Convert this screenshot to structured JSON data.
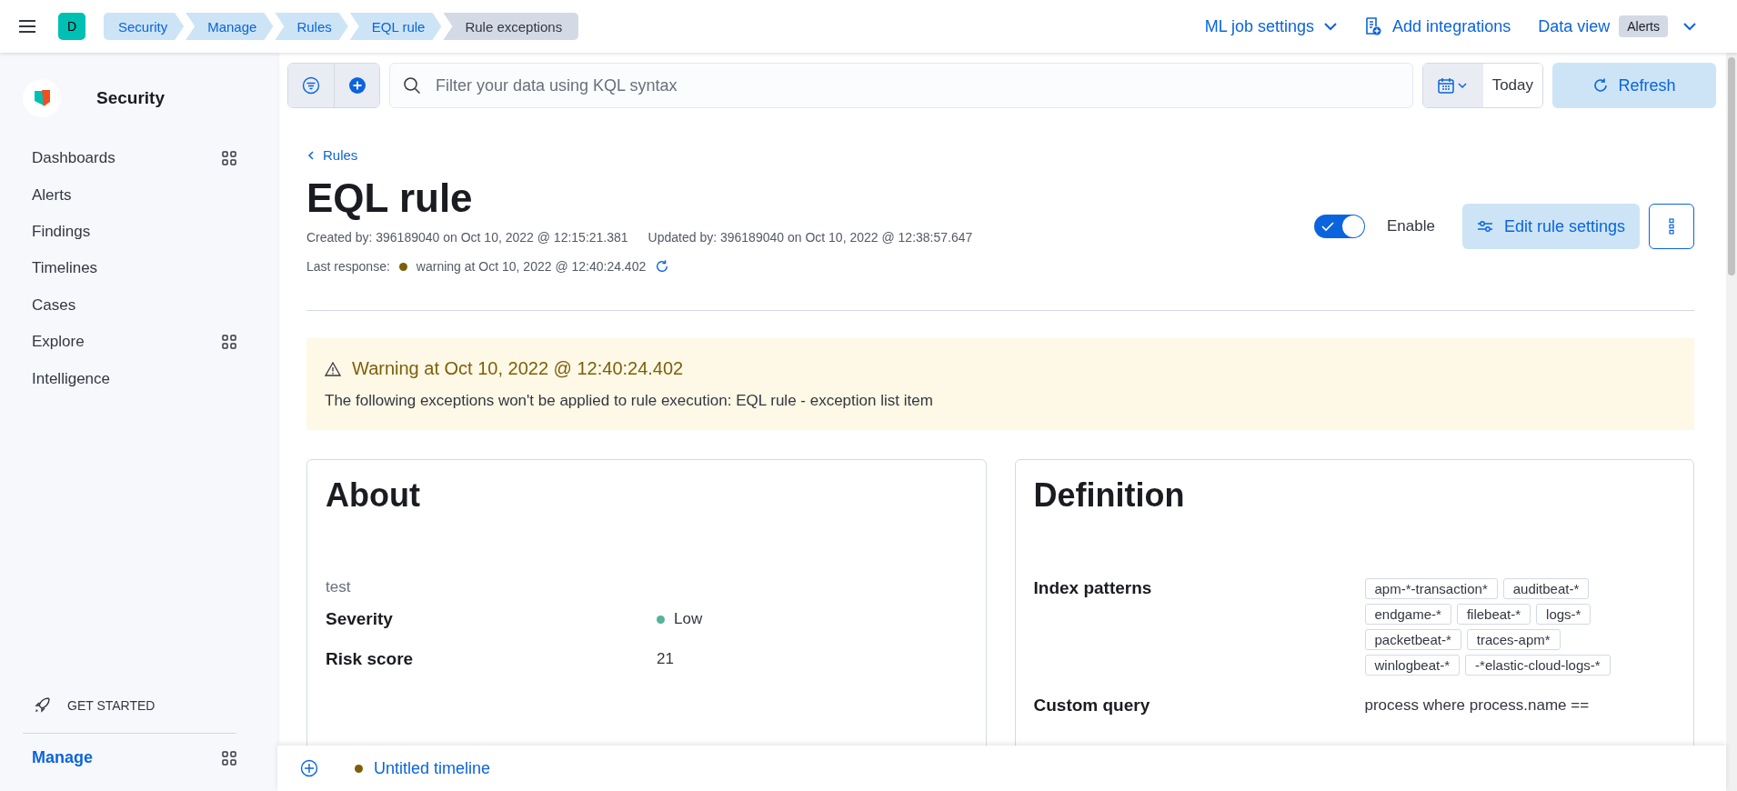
{
  "header": {
    "avatar": "D",
    "breadcrumbs": [
      {
        "label": "Security",
        "selected": false
      },
      {
        "label": "Manage",
        "selected": false
      },
      {
        "label": "Rules",
        "selected": false
      },
      {
        "label": "EQL rule",
        "selected": false
      },
      {
        "label": "Rule exceptions",
        "selected": true
      }
    ],
    "ml_job_settings": "ML job settings",
    "add_integrations": "Add integrations",
    "data_view": {
      "label": "Data view",
      "value": "Alerts"
    }
  },
  "sidebar": {
    "title": "Security",
    "items": [
      {
        "label": "Dashboards",
        "grid": true
      },
      {
        "label": "Alerts",
        "grid": false
      },
      {
        "label": "Findings",
        "grid": false
      },
      {
        "label": "Timelines",
        "grid": false
      },
      {
        "label": "Cases",
        "grid": false
      },
      {
        "label": "Explore",
        "grid": true
      },
      {
        "label": "Intelligence",
        "grid": false
      }
    ],
    "get_started": "GET STARTED",
    "manage": "Manage"
  },
  "query_bar": {
    "placeholder": "Filter your data using KQL syntax",
    "date": "Today",
    "refresh": "Refresh"
  },
  "rule": {
    "back": "Rules",
    "title": "EQL rule",
    "created": "Created by: 396189040 on Oct 10, 2022 @ 12:15:21.381",
    "updated": "Updated by: 396189040 on Oct 10, 2022 @ 12:38:57.647",
    "last_response_label": "Last response:",
    "last_response": "warning at Oct 10, 2022 @ 12:40:24.402",
    "enable": {
      "label": "Enable",
      "on": true
    },
    "edit": "Edit rule settings"
  },
  "warning": {
    "title": "Warning at Oct 10, 2022 @ 12:40:24.402",
    "text": "The following exceptions won't be applied to rule execution: EQL rule - exception list item"
  },
  "about": {
    "title": "About",
    "description": "test",
    "fields": [
      {
        "label": "Severity",
        "value": "Low",
        "color": "#54b399"
      },
      {
        "label": "Risk score",
        "value": "21"
      }
    ]
  },
  "definition": {
    "title": "Definition",
    "index_label": "Index patterns",
    "index_patterns": [
      [
        "apm-*-transaction*",
        "auditbeat-*"
      ],
      [
        "endgame-*",
        "filebeat-*",
        "logs-*"
      ],
      [
        "packetbeat-*",
        "traces-apm*"
      ],
      [
        "winlogbeat-*",
        "-*elastic-cloud-logs-*"
      ]
    ],
    "query_label": "Custom query",
    "query": "process where process.name =="
  },
  "timeline": {
    "label": "Untitled timeline",
    "color": "#7c5f0a"
  }
}
